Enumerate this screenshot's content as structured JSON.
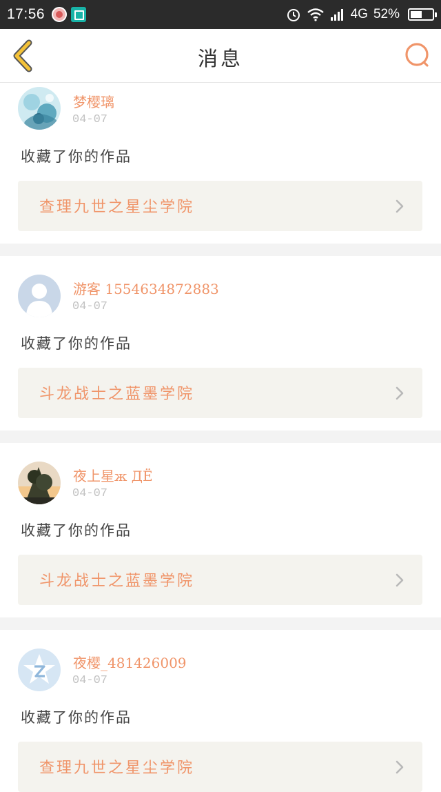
{
  "status_bar": {
    "time": "17:56",
    "network": "4G",
    "battery": "52%",
    "battery_level": 0.52,
    "icons": [
      "flower-app-icon",
      "scan-app-icon",
      "alarm-icon",
      "wifi-icon",
      "signal-icon",
      "battery-icon"
    ]
  },
  "header": {
    "title": "消息",
    "back_icon": "chevron-left-icon",
    "search_icon": "search-icon"
  },
  "colors": {
    "accent": "#f0956a",
    "back_icon": "#f4c238",
    "card_box": "#f4f3ee",
    "separator": "#f3f3f3",
    "status_bar": "#2b2b2b"
  },
  "messages": [
    {
      "username": "梦樱璃",
      "date": "04-07",
      "action": "收藏了你的作品",
      "work_title": "查理九世之星尘学院",
      "avatar": "anime-avatar"
    },
    {
      "username": "游客 1554634872883",
      "date": "04-07",
      "action": "收藏了你的作品",
      "work_title": "斗龙战士之蓝墨学院",
      "avatar": "default-avatar"
    },
    {
      "username": "夜上星ж ДЁ",
      "date": "04-07",
      "action": "收藏了你的作品",
      "work_title": "斗龙战士之蓝墨学院",
      "avatar": "tree-sunset-avatar"
    },
    {
      "username": "夜樱_481426009",
      "date": "04-07",
      "action": "收藏了你的作品",
      "work_title": "查理九世之星尘学院",
      "avatar": "qq-zone-avatar"
    }
  ]
}
